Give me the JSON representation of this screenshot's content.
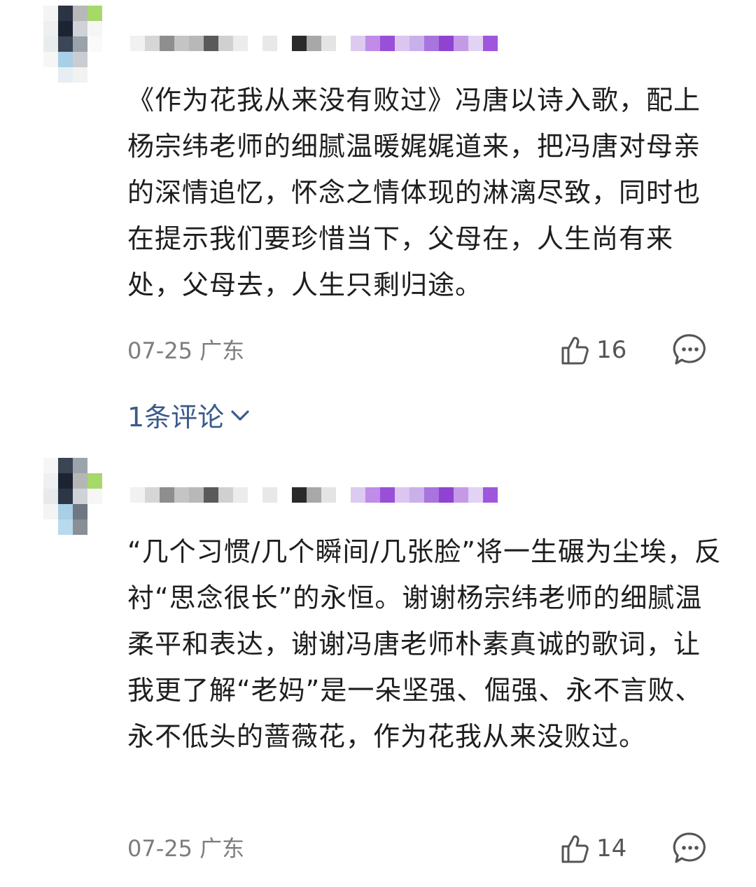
{
  "comments": [
    {
      "text": "《作为花我从来没有败过》冯唐以诗入歌，配上杨宗纬老师的细腻温暖娓娓道来，把冯唐对母亲的深情追忆，怀念之情体现的淋漓尽致，同时也在提示我们要珍惜当下，父母在，人生尚有来处，父母去，人生只剩归途。",
      "date": "07-25",
      "location": "广东",
      "likes": "16",
      "replies_label": "1条评论"
    },
    {
      "text": "“几个习惯/几个瞬间/几张脸”将一生碾为尘埃，反衬“思念很长”的永恒。谢谢杨宗纬老师的细腻温柔平和表达，谢谢冯唐老师朴素真诚的歌词，让我更了解“老妈”是一朵坚强、倔强、永不言败、永不低头的蔷薇花，作为花我从来没败过。",
      "date": "07-25",
      "location": "广东",
      "likes": "14"
    }
  ],
  "icons": {
    "like": "thumbs-up-icon",
    "reply": "chat-bubble-icon",
    "expand": "chevron-down-icon"
  },
  "colors": {
    "link": "#3a5a8c",
    "meta": "#7d7d7d",
    "text": "#1e1e1e"
  }
}
